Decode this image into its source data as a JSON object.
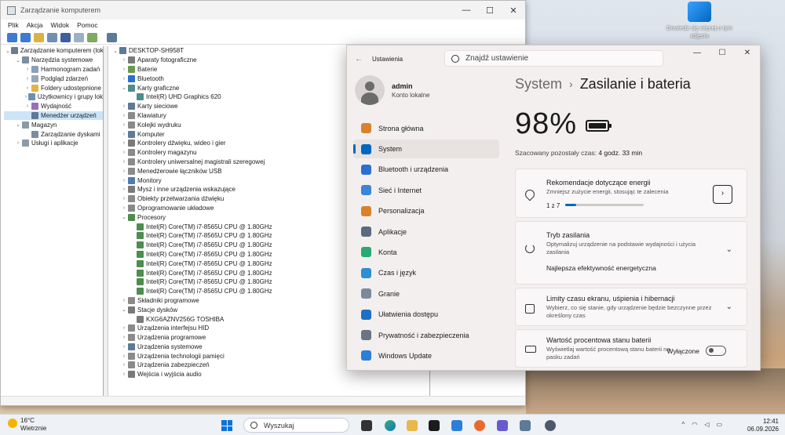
{
  "desktop": {
    "icon_label": "Dowiedz się więcej o tym zdjęciu"
  },
  "cm": {
    "title": "Zarządzanie komputerem",
    "controls": [
      "—",
      "☐",
      "✕"
    ],
    "menu": [
      "Plik",
      "Akcja",
      "Widok",
      "Pomoc"
    ],
    "left_tree": [
      {
        "label": "Zarządzanie komputerem (lokal",
        "lvl": 0,
        "ex": "⌄",
        "color": "#6b7c8f"
      },
      {
        "label": "Narzędzia systemowe",
        "lvl": 1,
        "ex": "⌄",
        "color": "#7c8ea0"
      },
      {
        "label": "Harmonogram zadań",
        "lvl": 2,
        "ex": "›",
        "color": "#8aa0b4"
      },
      {
        "label": "Podgląd zdarzeń",
        "lvl": 2,
        "ex": "›",
        "color": "#9aa8b8"
      },
      {
        "label": "Foldery udostępnione",
        "lvl": 2,
        "ex": "›",
        "color": "#e3b445"
      },
      {
        "label": "Użytkownicy i grupy lok",
        "lvl": 2,
        "ex": "›",
        "color": "#6f8fb4"
      },
      {
        "label": "Wydajność",
        "lvl": 2,
        "ex": "›",
        "color": "#9a6fb4"
      },
      {
        "label": "Menedżer urządzeń",
        "lvl": 2,
        "ex": "",
        "color": "#5d7a96",
        "selected": true
      },
      {
        "label": "Magazyn",
        "lvl": 1,
        "ex": "⌄",
        "color": "#8c9aa8"
      },
      {
        "label": "Zarządzanie dyskami",
        "lvl": 2,
        "ex": "",
        "color": "#7c8ea0"
      },
      {
        "label": "Usługi i aplikacje",
        "lvl": 1,
        "ex": "›",
        "color": "#8c9aa8"
      }
    ],
    "device_tree": [
      {
        "label": "DESKTOP-SH958T",
        "lvl": 0,
        "ex": "⌄",
        "color": "#5d7a96"
      },
      {
        "label": "Aparaty fotograficzne",
        "lvl": 1,
        "ex": "›",
        "color": "#7a7a7a"
      },
      {
        "label": "Baterie",
        "lvl": 1,
        "ex": "›",
        "color": "#6b9a4f"
      },
      {
        "label": "Bluetooth",
        "lvl": 1,
        "ex": "›",
        "color": "#2b6fd1"
      },
      {
        "label": "Karty graficzne",
        "lvl": 1,
        "ex": "⌄",
        "color": "#4f8c8c"
      },
      {
        "label": "Intel(R) UHD Graphics 620",
        "lvl": 2,
        "ex": "",
        "color": "#4f8c8c"
      },
      {
        "label": "Karty sieciowe",
        "lvl": 1,
        "ex": "›",
        "color": "#5d7a96"
      },
      {
        "label": "Klawiatury",
        "lvl": 1,
        "ex": "›",
        "color": "#8a8a8a"
      },
      {
        "label": "Kolejki wydruku",
        "lvl": 1,
        "ex": "›",
        "color": "#8a8a8a"
      },
      {
        "label": "Komputer",
        "lvl": 1,
        "ex": "›",
        "color": "#5d7a96"
      },
      {
        "label": "Kontrolery dźwięku, wideo i gier",
        "lvl": 1,
        "ex": "›",
        "color": "#7a7a7a"
      },
      {
        "label": "Kontrolery magazynu",
        "lvl": 1,
        "ex": "›",
        "color": "#8a8a8a"
      },
      {
        "label": "Kontrolery uniwersalnej magistrali szeregowej",
        "lvl": 1,
        "ex": "›",
        "color": "#8a8a8a"
      },
      {
        "label": "Menedżerowie łączników USB",
        "lvl": 1,
        "ex": "›",
        "color": "#8a8a8a"
      },
      {
        "label": "Monitory",
        "lvl": 1,
        "ex": "›",
        "color": "#4f7ab4"
      },
      {
        "label": "Mysz i inne urządzenia wskazujące",
        "lvl": 1,
        "ex": "›",
        "color": "#7a7a7a"
      },
      {
        "label": "Obiekty przetwarzania dźwięku",
        "lvl": 1,
        "ex": "›",
        "color": "#8a8a8a"
      },
      {
        "label": "Oprogramowanie układowe",
        "lvl": 1,
        "ex": "›",
        "color": "#8a8a8a"
      },
      {
        "label": "Procesory",
        "lvl": 1,
        "ex": "⌄",
        "color": "#4f8c4f"
      },
      {
        "label": "Intel(R) Core(TM) i7-8565U CPU @ 1.80GHz",
        "lvl": 2,
        "ex": "",
        "color": "#4f8c4f"
      },
      {
        "label": "Intel(R) Core(TM) i7-8565U CPU @ 1.80GHz",
        "lvl": 2,
        "ex": "",
        "color": "#4f8c4f"
      },
      {
        "label": "Intel(R) Core(TM) i7-8565U CPU @ 1.80GHz",
        "lvl": 2,
        "ex": "",
        "color": "#4f8c4f"
      },
      {
        "label": "Intel(R) Core(TM) i7-8565U CPU @ 1.80GHz",
        "lvl": 2,
        "ex": "",
        "color": "#4f8c4f"
      },
      {
        "label": "Intel(R) Core(TM) i7-8565U CPU @ 1.80GHz",
        "lvl": 2,
        "ex": "",
        "color": "#4f8c4f"
      },
      {
        "label": "Intel(R) Core(TM) i7-8565U CPU @ 1.80GHz",
        "lvl": 2,
        "ex": "",
        "color": "#4f8c4f"
      },
      {
        "label": "Intel(R) Core(TM) i7-8565U CPU @ 1.80GHz",
        "lvl": 2,
        "ex": "",
        "color": "#4f8c4f"
      },
      {
        "label": "Intel(R) Core(TM) i7-8565U CPU @ 1.80GHz",
        "lvl": 2,
        "ex": "",
        "color": "#4f8c4f"
      },
      {
        "label": "Składniki programowe",
        "lvl": 1,
        "ex": "›",
        "color": "#8a8a8a"
      },
      {
        "label": "Stacje dysków",
        "lvl": 1,
        "ex": "⌄",
        "color": "#7a7a7a"
      },
      {
        "label": "KXG6AZNV256G TOSHIBA",
        "lvl": 2,
        "ex": "",
        "color": "#7a7a7a"
      },
      {
        "label": "Urządzenia interfejsu HID",
        "lvl": 1,
        "ex": "›",
        "color": "#8a8a8a"
      },
      {
        "label": "Urządzenia programowe",
        "lvl": 1,
        "ex": "›",
        "color": "#8a8a8a"
      },
      {
        "label": "Urządzenia systemowe",
        "lvl": 1,
        "ex": "›",
        "color": "#5d7a96"
      },
      {
        "label": "Urządzenia technologii pamięci",
        "lvl": 1,
        "ex": "›",
        "color": "#8a8a8a"
      },
      {
        "label": "Urządzenia zabezpieczeń",
        "lvl": 1,
        "ex": "›",
        "color": "#8a8a8a"
      },
      {
        "label": "Wejścia i wyjścia audio",
        "lvl": 1,
        "ex": "›",
        "color": "#7a7a7a"
      }
    ]
  },
  "settings": {
    "app_title": "Ustawienia",
    "search_placeholder": "Znajdź ustawienie",
    "controls": [
      "—",
      "☐",
      "✕"
    ],
    "user": {
      "name": "admin",
      "role": "Konto lokalne"
    },
    "nav": [
      {
        "label": "Strona główna",
        "color": "#d9822b"
      },
      {
        "label": "System",
        "color": "#0067c0",
        "active": true
      },
      {
        "label": "Bluetooth i urządzenia",
        "color": "#2b6fd1"
      },
      {
        "label": "Sieć i Internet",
        "color": "#3a86d8"
      },
      {
        "label": "Personalizacja",
        "color": "#d9822b"
      },
      {
        "label": "Aplikacje",
        "color": "#5a6b80"
      },
      {
        "label": "Konta",
        "color": "#2aa876"
      },
      {
        "label": "Czas i język",
        "color": "#2b8fd1"
      },
      {
        "label": "Granie",
        "color": "#7a8a9a"
      },
      {
        "label": "Ułatwienia dostępu",
        "color": "#1f6fc4"
      },
      {
        "label": "Prywatność i zabezpieczenia",
        "color": "#6b7480"
      },
      {
        "label": "Windows Update",
        "color": "#2b7fd8"
      }
    ],
    "breadcrumb": {
      "parent": "System",
      "sep": "›",
      "current": "Zasilanie i bateria"
    },
    "battery": {
      "percent": "98%",
      "level": 0.98,
      "remaining_label": "Szacowany pozostały czas:",
      "remaining_value": "4 godz. 33 min"
    },
    "cards": {
      "energy": {
        "title": "Rekomendacje dotyczące energii",
        "sub": "Zmniejsz zużycie energii, stosując te zalecenia",
        "progress_text": "1 z 7",
        "progress": 0.14,
        "arrow": "›"
      },
      "power_mode": {
        "title": "Tryb zasilania",
        "sub": "Optymalizuj urządzenie na podstawie wydajności i użycia zasilania",
        "value": "Najlepsza efektywność energetyczna",
        "chev": "⌄"
      },
      "timeouts": {
        "title": "Limity czasu ekranu, uśpienia i hibernacji",
        "sub": "Wybierz, co się stanie, gdy urządzenie będzie bezczynne przez określony czas",
        "chev": "⌄"
      },
      "battery_pct": {
        "title": "Wartość procentowa stanu baterii",
        "sub": "Wyświetlaj wartość procentową stanu baterii na pasku zadań",
        "toggle_label": "Wyłączone"
      }
    }
  },
  "taskbar": {
    "weather_temp": "16°C",
    "weather_desc": "Wietrznie",
    "search": "Wyszukaj",
    "tray": "^",
    "time": "12:41",
    "date": "06.09.2026"
  }
}
